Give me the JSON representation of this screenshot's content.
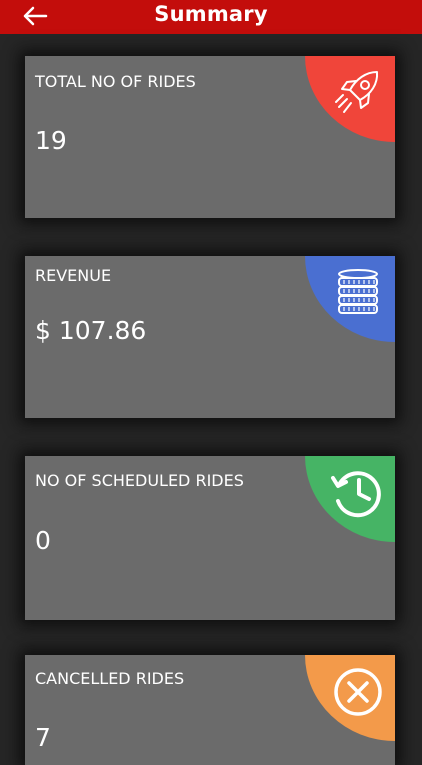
{
  "header": {
    "title": "Summary",
    "back_icon": "arrow-left-icon"
  },
  "colors": {
    "header_bg": "#c30d0b",
    "card_bg": "#6b6b6b",
    "rides_accent": "#f0453a",
    "revenue_accent": "#4a6fd1",
    "scheduled_accent": "#46b465",
    "cancelled_accent": "#f39a4a"
  },
  "cards": [
    {
      "label": "TOTAL NO OF RIDES",
      "value": "19",
      "icon": "rocket-icon"
    },
    {
      "label": "REVENUE",
      "value": "$ 107.86",
      "icon": "coins-icon"
    },
    {
      "label": "NO OF SCHEDULED RIDES",
      "value": "0",
      "icon": "history-clock-icon"
    },
    {
      "label": "CANCELLED RIDES",
      "value": "7",
      "icon": "cancel-circle-icon"
    }
  ]
}
